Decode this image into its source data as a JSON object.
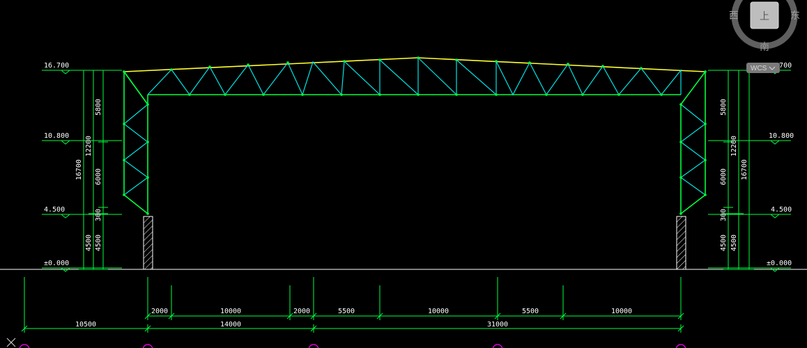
{
  "colors": {
    "background": "#000000",
    "column": "#00ff3c",
    "rafter_top": "#ffff30",
    "web": "#00e5e5",
    "dimension": "#00ff3c",
    "text": "#ffffff",
    "axis_bubble": "#ff00ff",
    "hatch": "#ffffff",
    "viewcube": "#9a9a9a"
  },
  "levels": {
    "left": [
      "16.700",
      "10.800",
      "4.500",
      "±0.000"
    ],
    "right": [
      "16.700",
      "10.800",
      "4.500",
      "±0.000"
    ]
  },
  "vertical_dims": {
    "left": {
      "total": "16700",
      "part_a": "12200",
      "part_b": "4500",
      "seg_1": "5800",
      "seg_2": "6000",
      "seg_3": "300",
      "seg_4": "4500"
    },
    "right": {
      "total": "16700",
      "part_a": "12200",
      "part_b": "4500",
      "seg_1": "5800",
      "seg_2": "6000",
      "seg_3": "300",
      "seg_4": "4500"
    }
  },
  "horizontal_dims": {
    "row1": [
      "2000",
      "10000",
      "2000",
      "5500",
      "10000",
      "5500",
      "10000"
    ],
    "row2": [
      "10500",
      "14000",
      "31000"
    ]
  },
  "viewcube": {
    "west": "西",
    "east": "东",
    "top": "上",
    "south": "南",
    "wcs": "WCS"
  },
  "icons": [
    "viewcube-icon",
    "ucs-icon"
  ]
}
